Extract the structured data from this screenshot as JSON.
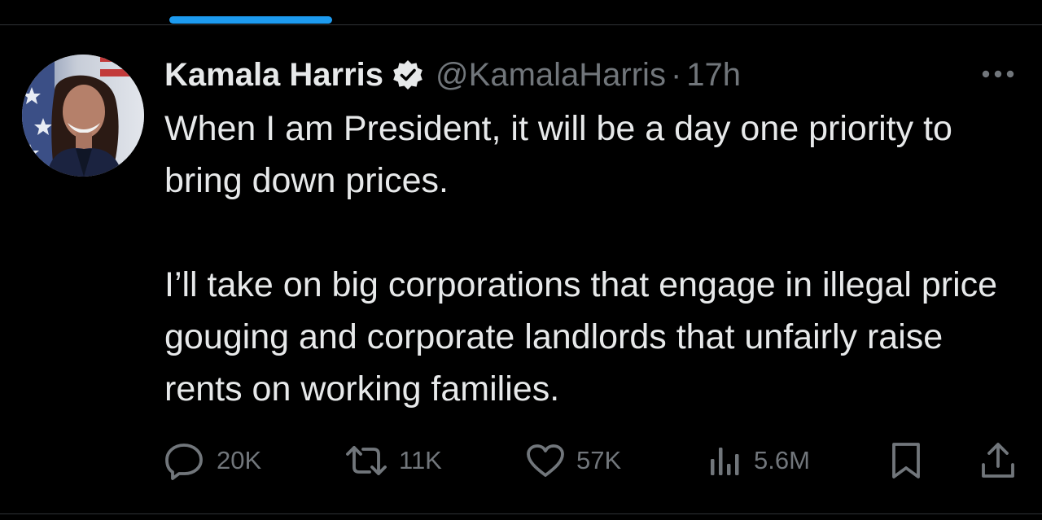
{
  "tweet": {
    "author": {
      "display_name": "Kamala Harris",
      "handle": "@KamalaHarris",
      "separator": "·",
      "time": "17h",
      "verified": true
    },
    "text_paragraphs": [
      "When I am President, it will be a day one priority to bring down prices.",
      "I’ll take on big corporations that engage in illegal price gouging and corporate landlords that unfairly raise rents on working families."
    ],
    "metrics": {
      "replies": "20K",
      "reposts": "11K",
      "likes": "57K",
      "views": "5.6M"
    },
    "icons": {
      "reply": "reply-icon",
      "repost": "repost-icon",
      "like": "heart-icon",
      "views": "views-icon",
      "bookmark": "bookmark-icon",
      "share": "share-icon",
      "more": "more-icon",
      "verified": "verified-badge-icon"
    }
  },
  "colors": {
    "background": "#000000",
    "text_primary": "#e7e9ea",
    "text_secondary": "#71767b",
    "accent": "#1d9bf0",
    "divider": "#2f3336"
  }
}
